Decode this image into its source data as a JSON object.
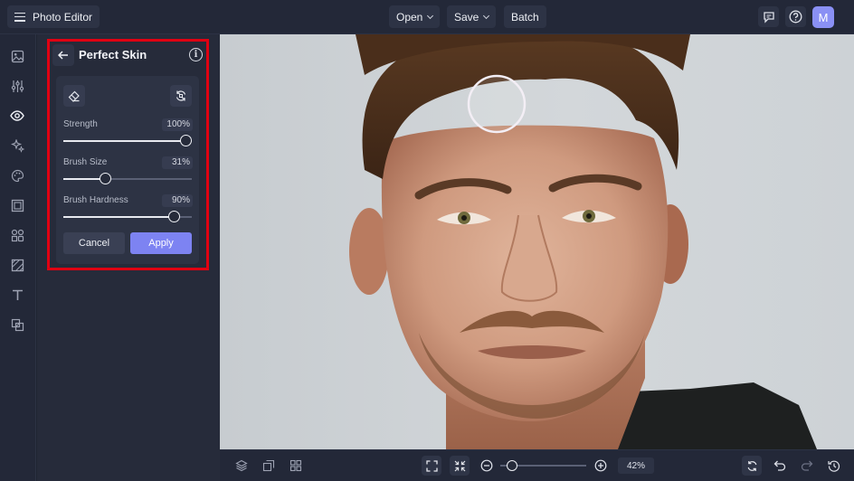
{
  "app": {
    "title": "Photo Editor"
  },
  "topbar": {
    "open_label": "Open",
    "save_label": "Save",
    "batch_label": "Batch",
    "avatar_initial": "M"
  },
  "panel": {
    "title": "Perfect Skin",
    "sliders": [
      {
        "label": "Strength",
        "value": "100%",
        "fraction": 1.0
      },
      {
        "label": "Brush Size",
        "value": "31%",
        "fraction": 0.31
      },
      {
        "label": "Brush Hardness",
        "value": "90%",
        "fraction": 0.9
      }
    ],
    "cancel_label": "Cancel",
    "apply_label": "Apply"
  },
  "bottombar": {
    "zoom_value": "42%",
    "zoom_fraction": 0.08
  },
  "colors": {
    "accent": "#7d83f2",
    "highlight_border": "#e00012",
    "background": "#1f2432"
  }
}
